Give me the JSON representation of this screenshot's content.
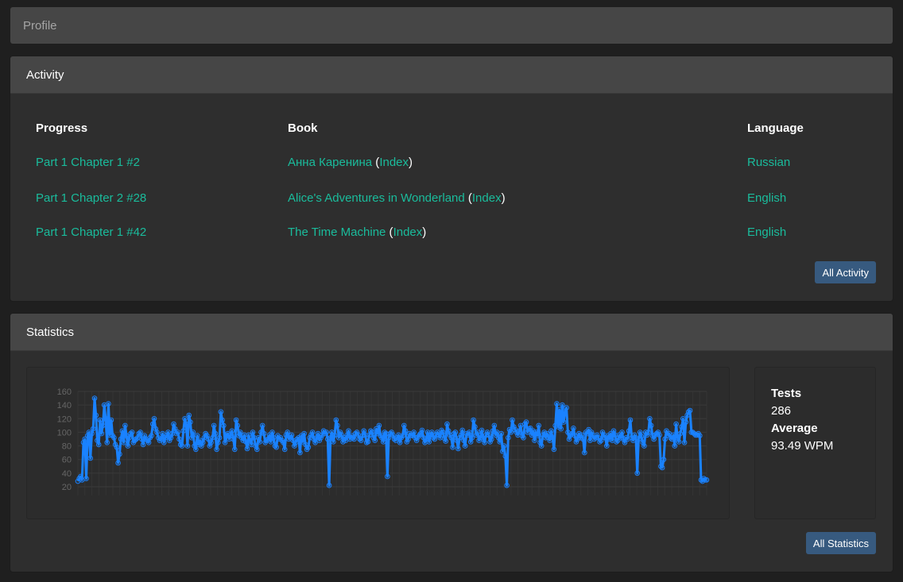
{
  "profile": {
    "label": "Profile"
  },
  "activity": {
    "title": "Activity",
    "columns": {
      "progress": "Progress",
      "book": "Book",
      "language": "Language"
    },
    "rows": [
      {
        "progress": "Part 1 Chapter 1 #2",
        "book": "Анна Каренина",
        "index": "Index",
        "language": "Russian"
      },
      {
        "progress": "Part 1 Chapter 2 #28",
        "book": "Alice's Adventures in Wonderland",
        "index": "Index",
        "language": "English"
      },
      {
        "progress": "Part 1 Chapter 1 #42",
        "book": "The Time Machine",
        "index": "Index",
        "language": "English"
      }
    ],
    "button": "All Activity"
  },
  "statistics": {
    "title": "Statistics",
    "tests_label": "Tests",
    "tests_value": "286",
    "average_label": "Average",
    "average_value": "93.49 WPM",
    "button": "All Statistics"
  },
  "colors": {
    "accent_link": "#1abc9c",
    "button": "#375a7f",
    "series": "#1a82ff"
  },
  "chart_data": {
    "type": "line",
    "title": "",
    "xlabel": "",
    "ylabel": "",
    "ylim": [
      20,
      160
    ],
    "yticks": [
      "20",
      "40",
      "60",
      "80",
      "100",
      "120",
      "140",
      "160"
    ],
    "grid": true,
    "series": [
      {
        "values": [
          28,
          32,
          35,
          30,
          85,
          90,
          32,
          95,
          100,
          62,
          98,
          105,
          150,
          125,
          88,
          82,
          118,
          98,
          110,
          140,
          120,
          85,
          142,
          96,
          118,
          95,
          92,
          82,
          78,
          55,
          68,
          90,
          102,
          85,
          110,
          95,
          80,
          92,
          98,
          100,
          85,
          88,
          90,
          92,
          98,
          100,
          90,
          82,
          95,
          90,
          88,
          85,
          92,
          95,
          112,
          120,
          105,
          100,
          92,
          88,
          90,
          98,
          85,
          92,
          95,
          100,
          88,
          92,
          98,
          112,
          105,
          98,
          100,
          90,
          82,
          80,
          102,
          120,
          112,
          80,
          125,
          115,
          92,
          100,
          80,
          75,
          95,
          82,
          88,
          80,
          85,
          92,
          98,
          95,
          90,
          80,
          85,
          92,
          110,
          98,
          75,
          85,
          92,
          130,
          118,
          110,
          85,
          95,
          98,
          90,
          96,
          102,
          90,
          75,
          118,
          110,
          95,
          100,
          92,
          88,
          96,
          86,
          76,
          96,
          88,
          82,
          100,
          92,
          80,
          75,
          92,
          86,
          100,
          110,
          98,
          85,
          88,
          90,
          96,
          86,
          100,
          92,
          80,
          78,
          95,
          90,
          92,
          88,
          85,
          75,
          96,
          100,
          90,
          92,
          96,
          88,
          80,
          85,
          90,
          92,
          70,
          95,
          86,
          98,
          82,
          75,
          78,
          92,
          96,
          100,
          90,
          85,
          92,
          98,
          88,
          92,
          96,
          102,
          98,
          100,
          90,
          22,
          92,
          100,
          86,
          96,
          118,
          110,
          92,
          100,
          96,
          86,
          92,
          88,
          96,
          102,
          90,
          95,
          92,
          90,
          98,
          100,
          96,
          90,
          88,
          95,
          102,
          96,
          85,
          86,
          96,
          102,
          100,
          92,
          88,
          105,
          98,
          110,
          95,
          92,
          86,
          100,
          98,
          35,
          92,
          98,
          100,
          96,
          90,
          88,
          92,
          96,
          85,
          92,
          95,
          110,
          102,
          86,
          90,
          98,
          96,
          95,
          100,
          92,
          88,
          93,
          96,
          98,
          103,
          92,
          85,
          90,
          100,
          86,
          96,
          100,
          92,
          90,
          96,
          100,
          96,
          92,
          103,
          100,
          91,
          87,
          112,
          102,
          96,
          92,
          78,
          98,
          100,
          88,
          76,
          92,
          96,
          103,
          88,
          80,
          98,
          96,
          100,
          86,
          92,
          118,
          108,
          96,
          100,
          88,
          92,
          103,
          90,
          85,
          96,
          100,
          96,
          86,
          90,
          102,
          110,
          96,
          100,
          92,
          86,
          98,
          72,
          80,
          65,
          22,
          92,
          104,
          100,
          118,
          108,
          104,
          100,
          96,
          102,
          110,
          95,
          92,
          112,
          115,
          100,
          105,
          106,
          96,
          102,
          88,
          100,
          95,
          110,
          85,
          80,
          96,
          100,
          92,
          98,
          92,
          88,
          102,
          92,
          75,
          110,
          142,
          108,
          133,
          105,
          140,
          115,
          130,
          136,
          100,
          90,
          96,
          98,
          106,
          95,
          86,
          90,
          98,
          92,
          96,
          90,
          70,
          100,
          98,
          104,
          88,
          100,
          96,
          90,
          92,
          96,
          92,
          86,
          88,
          100,
          96,
          92,
          80,
          95,
          90,
          98,
          88,
          102,
          96,
          86,
          88,
          96,
          92,
          100,
          90,
          85,
          92,
          90,
          102,
          118,
          92,
          88,
          96,
          92,
          40,
          90,
          100,
          94,
          85,
          80,
          100,
          96,
          100,
          120,
          110,
          95,
          90,
          96,
          98,
          100,
          96,
          50,
          48,
          60,
          90,
          102,
          96,
          98,
          92,
          90,
          96,
          80,
          112,
          92,
          86,
          98,
          108,
          120,
          85,
          115,
          125,
          130,
          132,
          100,
          100,
          98,
          96,
          96,
          98,
          95,
          30,
          28,
          32,
          30,
          30
        ]
      }
    ]
  }
}
